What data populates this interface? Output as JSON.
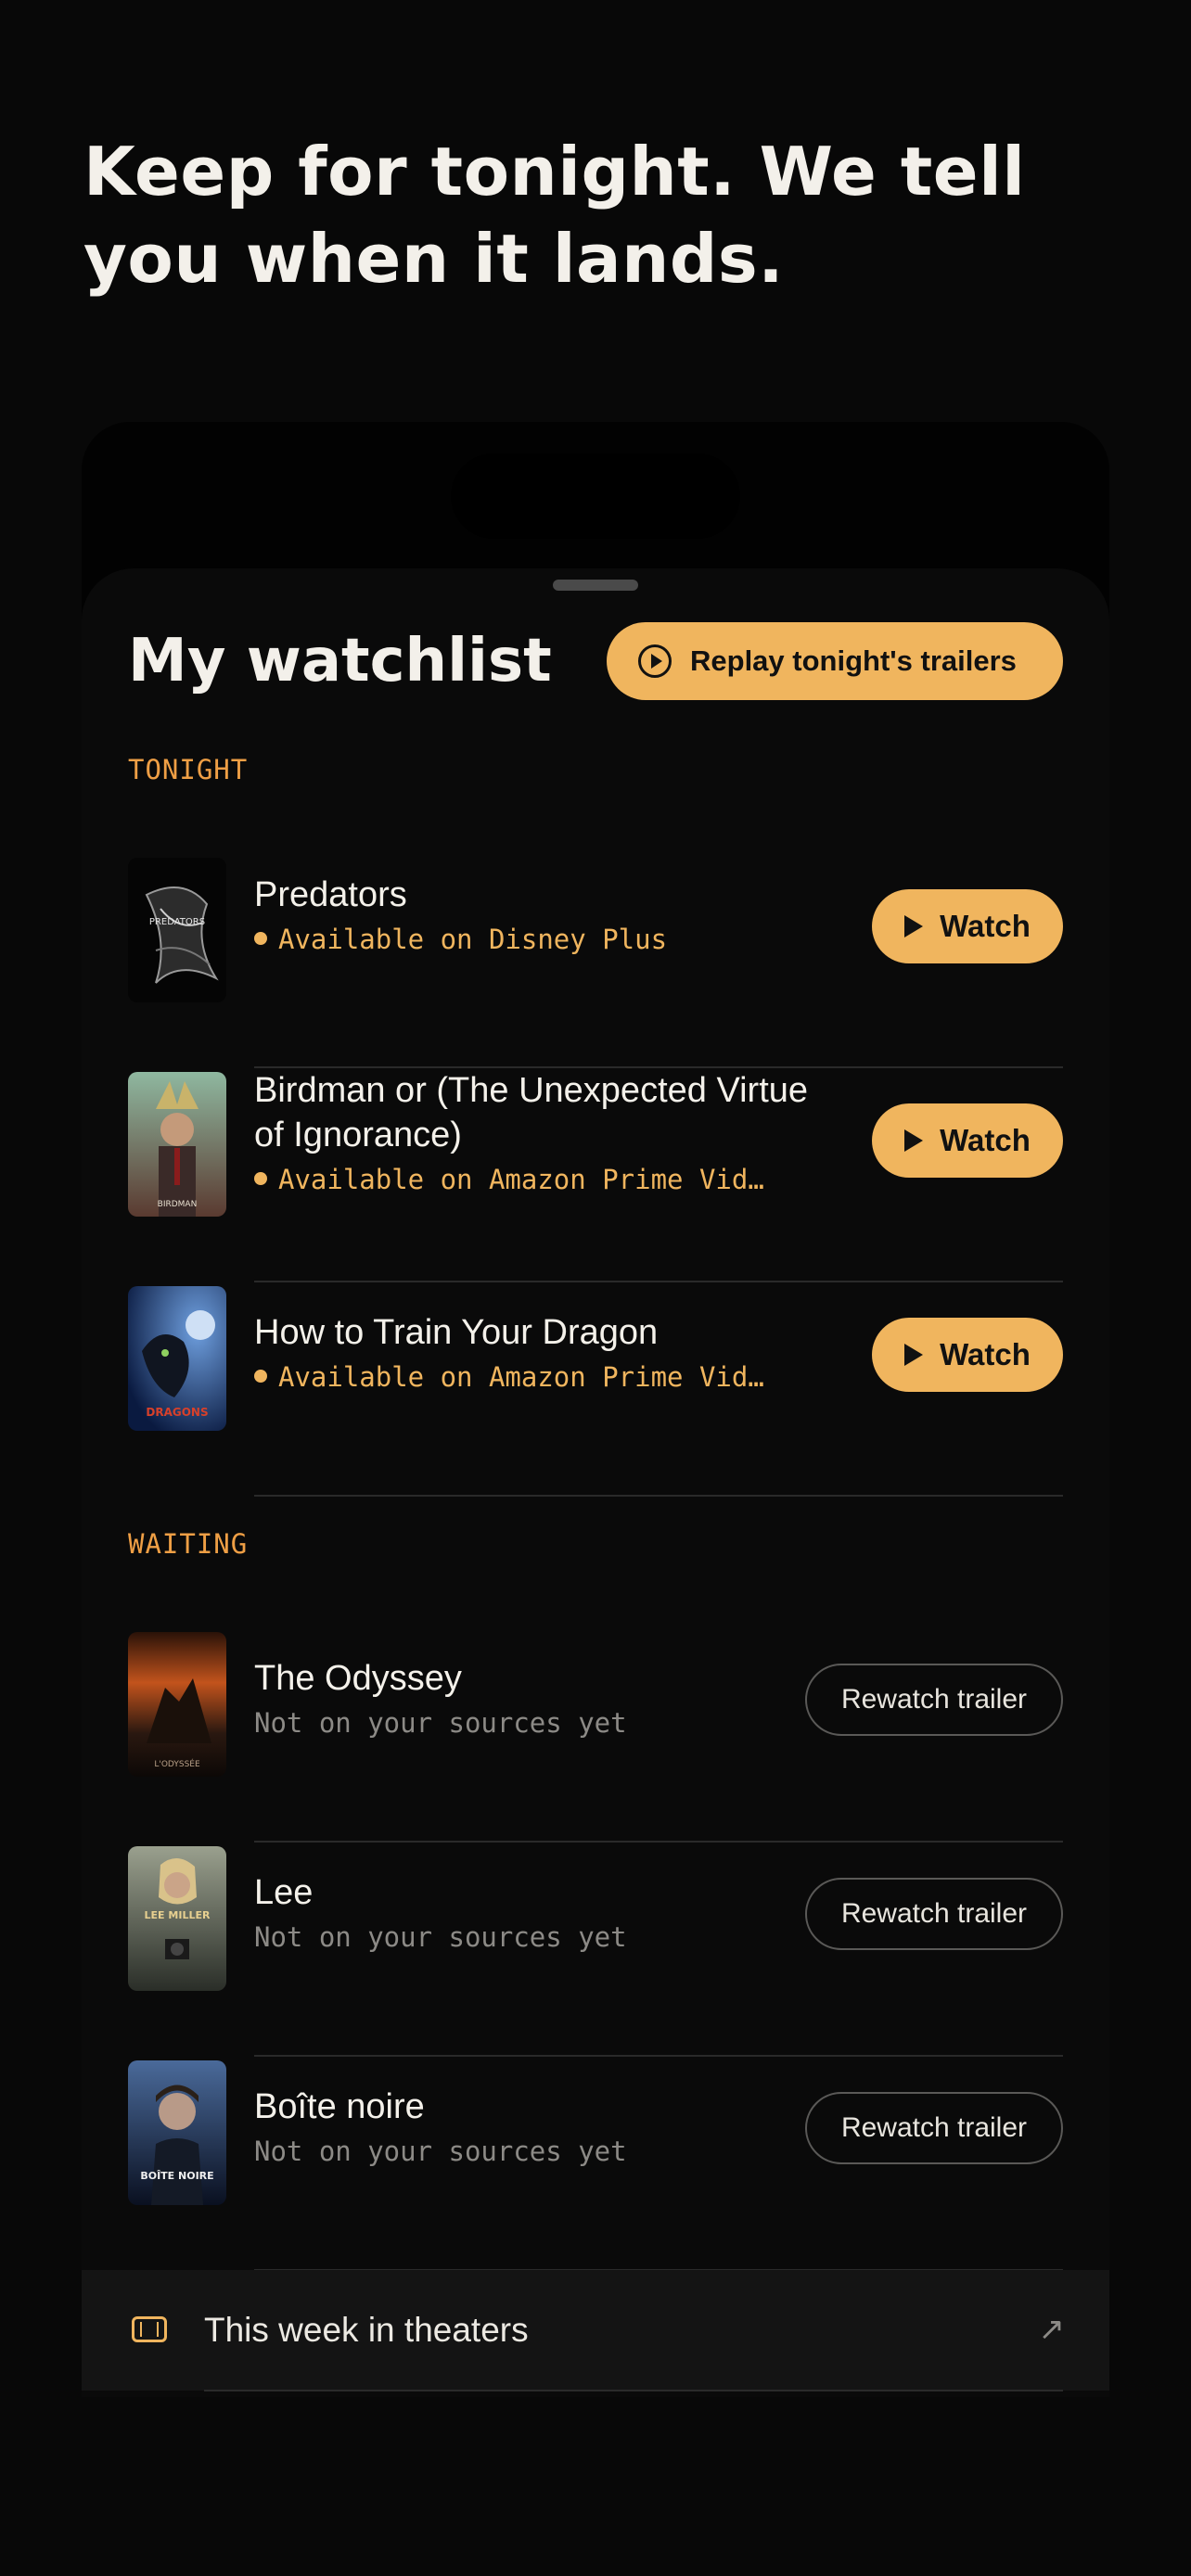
{
  "headline": "Keep for tonight. We tell you when it lands.",
  "watchlist": {
    "title": "My watchlist",
    "replay_button": {
      "label": "Replay tonight's trailers",
      "icon": "play-circle-icon"
    }
  },
  "sections": {
    "tonight": {
      "label": "TONIGHT",
      "items": [
        {
          "title": "Predators",
          "availability": "Available on Disney Plus",
          "poster_caption": "PREDATORS",
          "action": "Watch"
        },
        {
          "title": "Birdman or (The Unexpected Virtue of Ignorance)",
          "availability": "Available on Amazon Prime Vid…",
          "poster_caption": "BIRDMAN",
          "action": "Watch"
        },
        {
          "title": "How to Train Your Dragon",
          "availability": "Available on Amazon Prime Vid…",
          "poster_caption": "DRAGONS",
          "action": "Watch"
        }
      ]
    },
    "waiting": {
      "label": "WAITING",
      "items": [
        {
          "title": "The Odyssey",
          "status": "Not on your sources yet",
          "poster_caption": "L'ODYSSÉE",
          "action": "Rewatch trailer"
        },
        {
          "title": "Lee",
          "status": "Not on your sources yet",
          "poster_caption": "LEE MILLER",
          "action": "Rewatch trailer"
        },
        {
          "title": "Boîte noire",
          "status": "Not on your sources yet",
          "poster_caption": "BOÎTE NOIRE",
          "action": "Rewatch trailer"
        }
      ]
    }
  },
  "footer_link": {
    "label": "This week in theaters",
    "icon": "film-icon",
    "arrow_icon": "arrow-up-right-icon"
  },
  "colors": {
    "background": "#080808",
    "sheet": "#0a0a0a",
    "accent": "#f0b55e",
    "section_label": "#ef9f45",
    "muted_text": "#8c8a86",
    "divider": "#2a2a2a"
  }
}
